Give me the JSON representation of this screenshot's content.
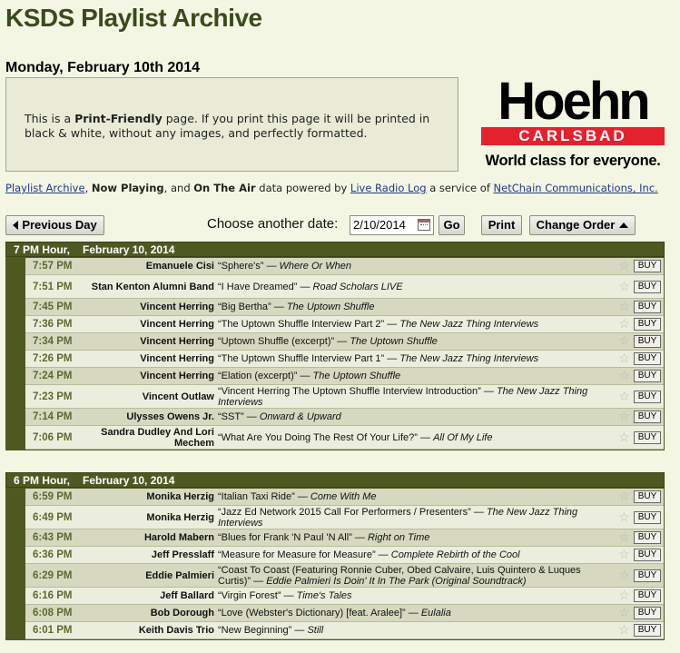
{
  "header": {
    "site_title": "KSDS Playlist Archive",
    "page_date": "Monday, February 10th 2014"
  },
  "print_box": {
    "prefix": "This is a ",
    "bold": "Print-Friendly",
    "suffix": " page. If you print this page it will be printed in black & white, without any images, and perfectly formatted."
  },
  "ad": {
    "brand": "Hoehn",
    "location": "CARLSBAD",
    "tagline": "World class for everyone."
  },
  "credits": {
    "link1": "Playlist Archive",
    "sep1": ", ",
    "now_playing": "Now Playing",
    "and": ", and ",
    "on_the_air": "On The Air",
    "powered_by": " data powered by ",
    "live_radio_log": "Live Radio Log",
    "a_service_of": " a service of ",
    "netchain": "NetChain Communications, Inc."
  },
  "controls": {
    "previous_day": "Previous Day",
    "choose_label": "Choose another date:",
    "date_value": "2/10/2014",
    "go": "Go",
    "print": "Print",
    "change_order": "Change Order"
  },
  "hours": [
    {
      "hour": "7 PM Hour,",
      "date": "February 10, 2014",
      "rows": [
        {
          "time": "7:57 PM",
          "artist": "Emanuele Cisi",
          "song": "“Sphere's”",
          "album": "Where Or When",
          "buy": "BUY"
        },
        {
          "time": "7:51 PM",
          "artist": "Stan Kenton Alumni Band",
          "song": "“I Have Dreamed”",
          "album": "Road Scholars LIVE",
          "buy": "BUY"
        },
        {
          "time": "7:45 PM",
          "artist": "Vincent Herring",
          "song": "“Big Bertha”",
          "album": "The Uptown Shuffle",
          "buy": "BUY"
        },
        {
          "time": "7:36 PM",
          "artist": "Vincent Herring",
          "song": "“The Uptown Shuffle Interview Part 2”",
          "album": "The New Jazz Thing Interviews",
          "buy": "BUY"
        },
        {
          "time": "7:34 PM",
          "artist": "Vincent Herring",
          "song": "“Uptown Shuffle (excerpt)”",
          "album": "The Uptown Shuffle",
          "buy": "BUY"
        },
        {
          "time": "7:26 PM",
          "artist": "Vincent Herring",
          "song": "“The Uptown Shuffle Interview Part 1”",
          "album": "The New Jazz Thing Interviews",
          "buy": "BUY"
        },
        {
          "time": "7:24 PM",
          "artist": "Vincent Herring",
          "song": "“Elation (excerpt)”",
          "album": "The Uptown Shuffle",
          "buy": "BUY"
        },
        {
          "time": "7:23 PM",
          "artist": "Vincent Outlaw",
          "song": "“Vincent Herring The Uptown Shuffle Interview Introduction”",
          "album": "The New Jazz Thing Interviews",
          "buy": "BUY"
        },
        {
          "time": "7:14 PM",
          "artist": "Ulysses Owens Jr.",
          "song": "“SST”",
          "album": "Onward & Upward",
          "buy": "BUY"
        },
        {
          "time": "7:06 PM",
          "artist": "Sandra Dudley And Lori Mechem",
          "song": "“What Are You Doing The Rest Of Your Life?”",
          "album": "All Of My Life",
          "buy": "BUY"
        }
      ]
    },
    {
      "hour": "6 PM Hour,",
      "date": "February 10, 2014",
      "rows": [
        {
          "time": "6:59 PM",
          "artist": "Monika Herzig",
          "song": "“Italian Taxi Ride”",
          "album": "Come With Me",
          "buy": "BUY"
        },
        {
          "time": "6:49 PM",
          "artist": "Monika Herzig",
          "song": "“Jazz Ed Network 2015 Call For Performers / Presenters”",
          "album": "The New Jazz Thing Interviews",
          "buy": "BUY"
        },
        {
          "time": "6:43 PM",
          "artist": "Harold Mabern",
          "song": "“Blues for Frank 'N Paul 'N All”",
          "album": "Right on Time",
          "buy": "BUY"
        },
        {
          "time": "6:36 PM",
          "artist": "Jeff Presslaff",
          "song": "“Measure for Measure for Measure”",
          "album": "Complete Rebirth of the Cool",
          "buy": "BUY"
        },
        {
          "time": "6:29 PM",
          "artist": "Eddie Palmieri",
          "song": "“Coast To Coast (Featuring Ronnie Cuber, Obed Calvaire, Luis Quintero & Luques Curtis)”",
          "album": "Eddie Palmieri Is Doin' It In The Park (Original Soundtrack)",
          "buy": "BUY"
        },
        {
          "time": "6:16 PM",
          "artist": "Jeff Ballard",
          "song": "“Virgin Forest”",
          "album": "Time's Tales",
          "buy": "BUY"
        },
        {
          "time": "6:08 PM",
          "artist": "Bob Dorough",
          "song": "“Love (Webster's Dictionary) [feat. Aralee]”",
          "album": "Eulalia",
          "buy": "BUY"
        },
        {
          "time": "6:01 PM",
          "artist": "Keith Davis Trio",
          "song": "“New Beginning”",
          "album": "Still",
          "buy": "BUY"
        }
      ]
    }
  ]
}
